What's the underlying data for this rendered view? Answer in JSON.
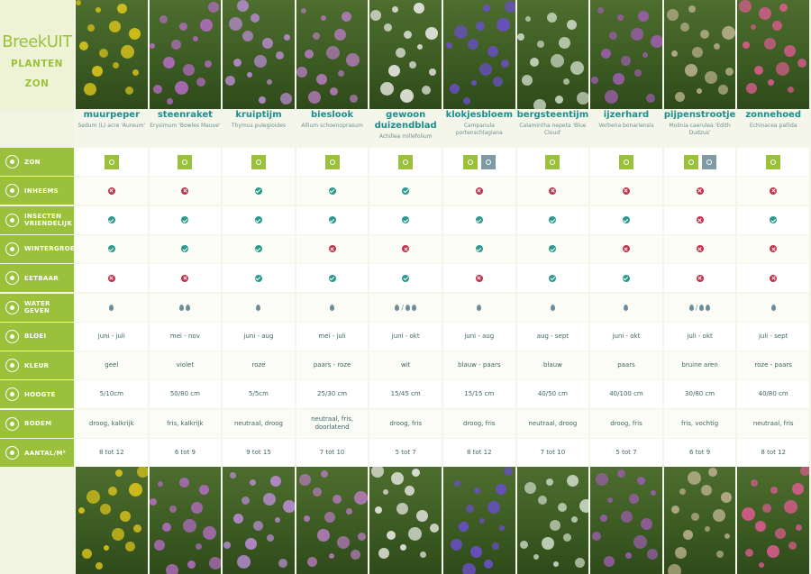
{
  "brand": {
    "name": "BreekUIT",
    "line1": "PLANTEN",
    "line2": "ZON"
  },
  "rows": [
    {
      "key": "zon",
      "label": "ZON",
      "icon": "sun-icon"
    },
    {
      "key": "inheems",
      "label": "INHEEMS",
      "icon": "leaf-icon"
    },
    {
      "key": "insecten",
      "label": "INSECTEN VRIENDELIJK",
      "icon": "bee-icon"
    },
    {
      "key": "wintergroen",
      "label": "WINTERGROEN",
      "icon": "snowflake-icon"
    },
    {
      "key": "eetbaar",
      "label": "EETBAAR",
      "icon": "apple-icon"
    },
    {
      "key": "water",
      "label": "WATER GEVEN",
      "icon": "water-drop-icon"
    },
    {
      "key": "bloei",
      "label": "BLOEI",
      "icon": "flower-icon"
    },
    {
      "key": "kleur",
      "label": "KLEUR",
      "icon": "palette-icon"
    },
    {
      "key": "hoogte",
      "label": "HOOGTE",
      "icon": "height-icon"
    },
    {
      "key": "bodem",
      "label": "BODEM",
      "icon": "soil-icon"
    },
    {
      "key": "aantal",
      "label": "AANTAL/M²",
      "icon": "area-icon"
    }
  ],
  "plants": [
    {
      "name": "muurpeper",
      "latin": "Sedum (L) acre 'Aureum'",
      "sun": [
        "full"
      ],
      "inheems": false,
      "insecten": true,
      "wintergroen": true,
      "eetbaar": false,
      "water": "1",
      "bloei": "juni - juli",
      "kleur": "geel",
      "hoogte": "5/10cm",
      "bodem": "droog, kalkrijk",
      "aantal": "8 tot 12",
      "color": "#d8c21c"
    },
    {
      "name": "steenraket",
      "latin": "Erysimum 'Bowles Mauve'",
      "sun": [
        "full"
      ],
      "inheems": false,
      "insecten": true,
      "wintergroen": true,
      "eetbaar": false,
      "water": "2",
      "bloei": "mei - nov",
      "kleur": "violet",
      "hoogte": "50/80 cm",
      "bodem": "fris, kalkrijk",
      "aantal": "6 tot 9",
      "color": "#b06bbd"
    },
    {
      "name": "kruiptijm",
      "latin": "Thymus pulegioides",
      "sun": [
        "full"
      ],
      "inheems": true,
      "insecten": true,
      "wintergroen": true,
      "eetbaar": true,
      "water": "1",
      "bloei": "juni - aug",
      "kleur": "roze",
      "hoogte": "5/5cm",
      "bodem": "neutraal, droog",
      "aantal": "9 tot 15",
      "color": "#b88bd0"
    },
    {
      "name": "bieslook",
      "latin": "Allium schoenoprasum",
      "sun": [
        "full"
      ],
      "inheems": true,
      "insecten": true,
      "wintergroen": false,
      "eetbaar": true,
      "water": "1",
      "bloei": "mei - juli",
      "kleur": "paars - roze",
      "hoogte": "25/30 cm",
      "bodem": "neutraal, fris, doorlatend",
      "aantal": "7 tot 10",
      "color": "#b27ab8"
    },
    {
      "name": "gewoon duizendblad",
      "latin": "Achillea millefolium",
      "sun": [
        "full"
      ],
      "inheems": true,
      "insecten": true,
      "wintergroen": false,
      "eetbaar": true,
      "water": "1/2",
      "bloei": "juni - okt",
      "kleur": "wit",
      "hoogte": "15/45 cm",
      "bodem": "droog, fris",
      "aantal": "5 tot 7",
      "color": "#e6e6e0"
    },
    {
      "name": "klokjesbloem",
      "latin": "Campanula portenschlagiana",
      "sun": [
        "full",
        "half"
      ],
      "inheems": false,
      "insecten": true,
      "wintergroen": true,
      "eetbaar": false,
      "water": "1",
      "bloei": "juni - aug",
      "kleur": "blauw - paars",
      "hoogte": "15/15 cm",
      "bodem": "droog, fris",
      "aantal": "8 tot 12",
      "color": "#6a4fc8"
    },
    {
      "name": "bergsteentijm",
      "latin": "Calamintha nepeta 'Blue Cloud'",
      "sun": [
        "full"
      ],
      "inheems": false,
      "insecten": true,
      "wintergroen": true,
      "eetbaar": true,
      "water": "1",
      "bloei": "aug - sept",
      "kleur": "blauw",
      "hoogte": "40/50 cm",
      "bodem": "neutraal, droog",
      "aantal": "7 tot 10",
      "color": "#c9d6c2"
    },
    {
      "name": "ijzerhard",
      "latin": "Verbena bonariensis",
      "sun": [
        "full"
      ],
      "inheems": false,
      "insecten": true,
      "wintergroen": false,
      "eetbaar": true,
      "water": "1",
      "bloei": "juni - okt",
      "kleur": "paars",
      "hoogte": "40/100 cm",
      "bodem": "droog, fris",
      "aantal": "5 tot 7",
      "color": "#9a5da8"
    },
    {
      "name": "pijpenstrootje",
      "latin": "Molinia caerulea 'Edith Dudzus'",
      "sun": [
        "full",
        "half"
      ],
      "inheems": false,
      "insecten": false,
      "wintergroen": false,
      "eetbaar": false,
      "water": "1/2",
      "bloei": "juli - okt",
      "kleur": "bruine aren",
      "hoogte": "30/80 cm",
      "bodem": "fris, vochtig",
      "aantal": "6 tot 9",
      "color": "#b7ae8a"
    },
    {
      "name": "zonnehoed",
      "latin": "Echinacea pallida",
      "sun": [
        "full"
      ],
      "inheems": false,
      "insecten": true,
      "wintergroen": false,
      "eetbaar": false,
      "water": "1",
      "bloei": "juli - sept",
      "kleur": "roze - paars",
      "hoogte": "40/80 cm",
      "bodem": "neutraal, fris",
      "aantal": "8 tot 12",
      "color": "#d55b8c"
    }
  ],
  "colors": {
    "accent": "#9bc13c",
    "teal": "#1d8d8e",
    "yes": "#2a9a8f",
    "no": "#c2314d"
  }
}
